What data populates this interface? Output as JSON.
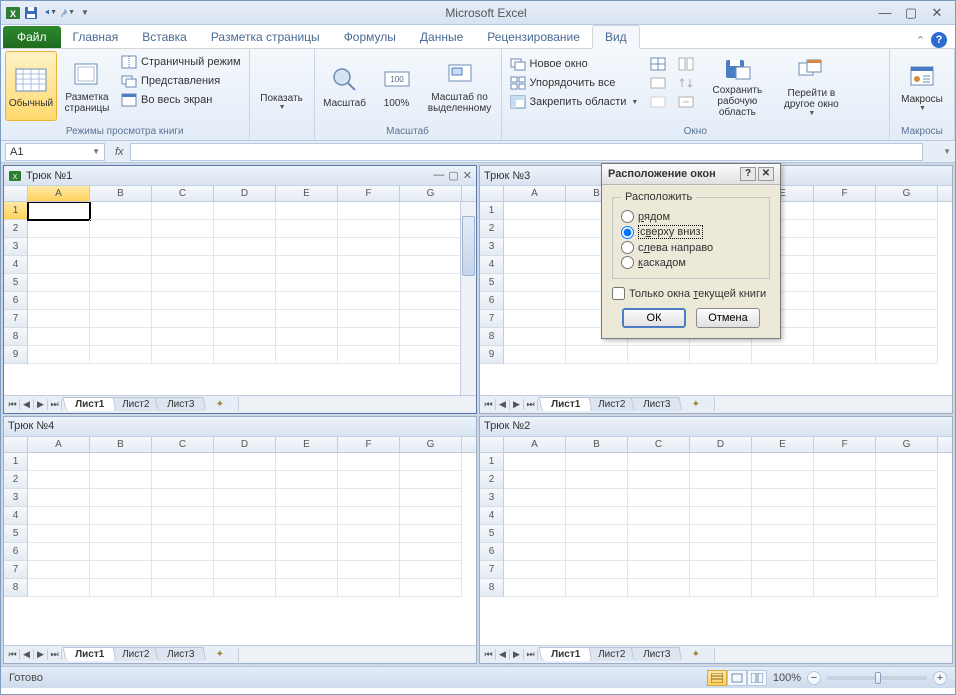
{
  "app": {
    "title": "Microsoft Excel"
  },
  "tabs": {
    "file": "Файл",
    "items": [
      "Главная",
      "Вставка",
      "Разметка страницы",
      "Формулы",
      "Данные",
      "Рецензирование",
      "Вид"
    ],
    "active": "Вид"
  },
  "ribbon": {
    "views": {
      "normal": "Обычный",
      "page_layout": "Разметка страницы",
      "page_break": "Страничный режим",
      "custom_views": "Представления",
      "full_screen": "Во весь экран",
      "group": "Режимы просмотра книги"
    },
    "show": {
      "btn": "Показать",
      "group": ""
    },
    "zoom": {
      "zoom": "Масштаб",
      "hundred": "100%",
      "to_selection": "Масштаб по выделенному",
      "group": "Масштаб"
    },
    "window": {
      "new_window": "Новое окно",
      "arrange": "Упорядочить все",
      "freeze": "Закрепить области",
      "save_workspace": "Сохранить рабочую область",
      "switch": "Перейти в другое окно",
      "group": "Окно"
    },
    "macros": {
      "btn": "Макросы",
      "group": "Макросы"
    }
  },
  "formula": {
    "cell_ref": "A1"
  },
  "workbooks": [
    {
      "title": "Трюк №1",
      "active": true,
      "sheets": [
        "Лист1",
        "Лист2",
        "Лист3"
      ]
    },
    {
      "title": "Трюк №3",
      "active": false,
      "sheets": [
        "Лист1",
        "Лист2",
        "Лист3"
      ]
    },
    {
      "title": "Трюк №4",
      "active": false,
      "sheets": [
        "Лист1",
        "Лист2",
        "Лист3"
      ]
    },
    {
      "title": "Трюк №2",
      "active": false,
      "sheets": [
        "Лист1",
        "Лист2",
        "Лист3"
      ]
    }
  ],
  "columns": [
    "A",
    "B",
    "C",
    "D",
    "E",
    "F",
    "G"
  ],
  "rows": [
    1,
    2,
    3,
    4,
    5,
    6,
    7,
    8,
    9
  ],
  "dialog": {
    "title": "Расположение окон",
    "legend": "Расположить",
    "opt_tiled": "рядом",
    "opt_horizontal": "сверху вниз",
    "opt_vertical": "слева направо",
    "opt_cascade": "каскадом",
    "chk_current": "Только окна текущей книги",
    "ok": "ОК",
    "cancel": "Отмена"
  },
  "status": {
    "ready": "Готово",
    "zoom": "100%"
  }
}
